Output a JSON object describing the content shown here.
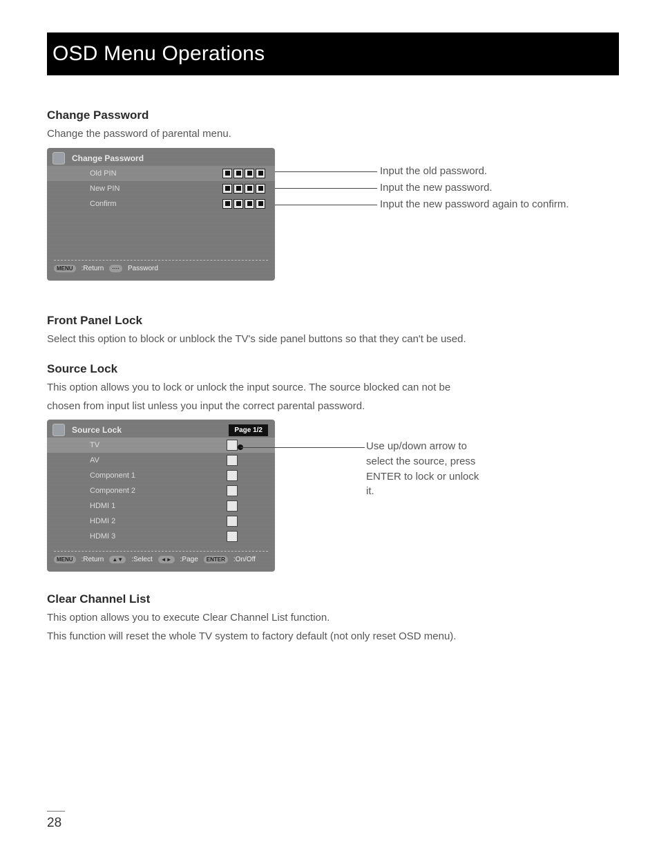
{
  "banner_title": "OSD Menu Operations",
  "page_number": "28",
  "sections": {
    "change_password": {
      "heading": "Change Password",
      "desc": "Change the password of parental menu.",
      "osd_title": "Change Password",
      "fields": [
        {
          "label": "Old PIN"
        },
        {
          "label": "New PIN"
        },
        {
          "label": "Confirm"
        }
      ],
      "footer": [
        {
          "btn": "MENU",
          "label": ":Return"
        },
        {
          "btn": "····",
          "label": "Password"
        }
      ],
      "callouts": [
        "Input the old password.",
        "Input the new password.",
        "Input the new password again to confirm."
      ]
    },
    "front_panel_lock": {
      "heading": "Front Panel Lock",
      "desc": "Select this option to block or unblock the TV's side panel buttons so that they can't be used."
    },
    "source_lock": {
      "heading": "Source Lock",
      "desc1": "This option allows you to lock or unlock the input source. The source blocked can not be",
      "desc2": "chosen from input list unless you input the correct parental password.",
      "osd_title": "Source Lock",
      "page_label": "Page 1/2",
      "sources": [
        "TV",
        "AV",
        "Component 1",
        "Component 2",
        "HDMI 1",
        "HDMI 2",
        "HDMI 3"
      ],
      "footer": [
        {
          "btn": "MENU",
          "label": ":Return"
        },
        {
          "btn": "▲▼",
          "label": ":Select"
        },
        {
          "btn": "◄►",
          "label": ":Page"
        },
        {
          "btn": "ENTER",
          "label": ":On/Off"
        }
      ],
      "callout": "Use up/down arrow to select the source, press ENTER to lock or unlock it."
    },
    "clear_channel_list": {
      "heading": "Clear Channel List",
      "desc1": "This option allows you to execute Clear Channel List function.",
      "desc2": "This function will reset the whole TV system to factory default (not only reset OSD menu)."
    }
  }
}
